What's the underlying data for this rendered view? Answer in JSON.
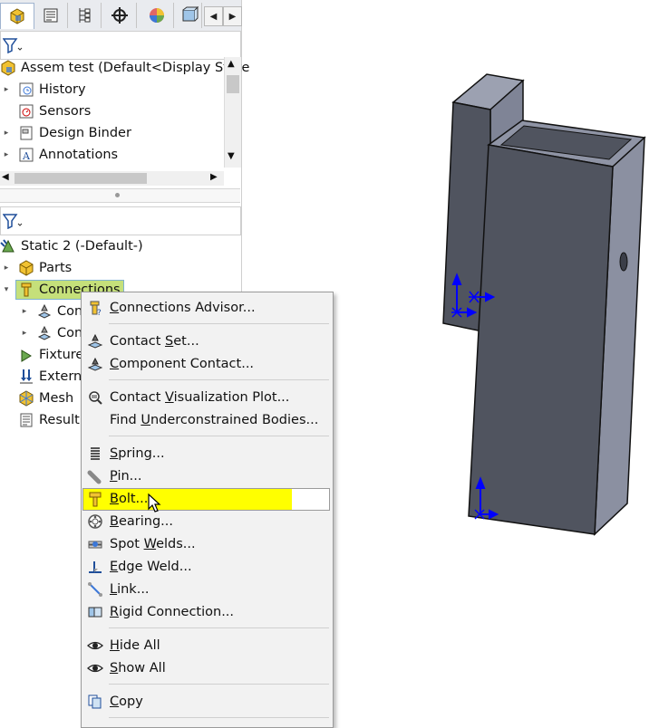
{
  "tabs": [
    {
      "name": "feature-manager-tab",
      "icon": "assembly-icon",
      "active": true
    },
    {
      "name": "property-manager-tab",
      "icon": "property-icon",
      "active": false
    },
    {
      "name": "configuration-manager-tab",
      "icon": "configuration-icon",
      "active": false
    },
    {
      "name": "dimxpert-tab",
      "icon": "crosshair-icon",
      "active": false
    },
    {
      "name": "display-manager-tab",
      "icon": "color-wheel-icon",
      "active": false
    },
    {
      "name": "extra-tab",
      "icon": "cube-tab-icon",
      "active": false
    }
  ],
  "feature_tree": {
    "root": "Assem test  (Default<Display State",
    "items": [
      {
        "label": "History",
        "icon": "history-icon",
        "arrow": "▸"
      },
      {
        "label": "Sensors",
        "icon": "sensor-icon",
        "arrow": ""
      },
      {
        "label": "Design Binder",
        "icon": "binder-icon",
        "arrow": "▸"
      },
      {
        "label": "Annotations",
        "icon": "annotation-icon",
        "arrow": "▸"
      }
    ]
  },
  "sim_tree": {
    "root": "Static 2 (-Default-)",
    "items": [
      {
        "label": "Parts",
        "arrow": "▸"
      },
      {
        "label": "Connections",
        "arrow": "▾",
        "selected": true
      },
      {
        "label": "Con",
        "arrow": "▸",
        "indent": true
      },
      {
        "label": "Con",
        "arrow": "▸",
        "indent": true
      },
      {
        "label": "Fixtures",
        "arrow": ""
      },
      {
        "label": "Externa",
        "arrow": ""
      },
      {
        "label": "Mesh",
        "arrow": ""
      },
      {
        "label": "Result O",
        "arrow": ""
      }
    ]
  },
  "context_menu": {
    "items": [
      {
        "pre": "",
        "key": "C",
        "post": "onnections Advisor...",
        "icon": "advisor-icon"
      },
      {
        "pre": "Contact ",
        "key": "S",
        "post": "et...",
        "icon": "contact-set-icon"
      },
      {
        "pre": "",
        "key": "C",
        "post": "omponent Contact...",
        "icon": "component-contact-icon"
      },
      {
        "pre": "Contact ",
        "key": "V",
        "post": "isualization Plot...",
        "icon": "visualization-icon"
      },
      {
        "pre": "Find ",
        "key": "U",
        "post": "nderconstrained Bodies...",
        "icon": ""
      },
      {
        "pre": "",
        "key": "S",
        "post": "pring...",
        "icon": "spring-icon"
      },
      {
        "pre": "",
        "key": "P",
        "post": "in...",
        "icon": "pin-icon"
      },
      {
        "pre": "",
        "key": "B",
        "post": "olt...",
        "icon": "bolt-icon"
      },
      {
        "pre": "",
        "key": "B",
        "post": "earing...",
        "icon": "bearing-icon"
      },
      {
        "pre": "Spot ",
        "key": "W",
        "post": "elds...",
        "icon": "spot-weld-icon"
      },
      {
        "pre": "",
        "key": "E",
        "post": "dge Weld...",
        "icon": "edge-weld-icon"
      },
      {
        "pre": "",
        "key": "L",
        "post": "ink...",
        "icon": "link-icon"
      },
      {
        "pre": "",
        "key": "R",
        "post": "igid Connection...",
        "icon": "rigid-icon"
      },
      {
        "pre": "",
        "key": "H",
        "post": "ide All",
        "icon": "eye-icon"
      },
      {
        "pre": "",
        "key": "S",
        "post": "how All",
        "icon": "eye-icon"
      },
      {
        "pre": "",
        "key": "C",
        "post": "opy",
        "icon": "copy-icon"
      }
    ]
  },
  "colors": {
    "highlight_yellow": "#ffff00",
    "model_face": "#50545f",
    "model_side": "#8b90a1",
    "triad_blue": "#0000ff"
  }
}
